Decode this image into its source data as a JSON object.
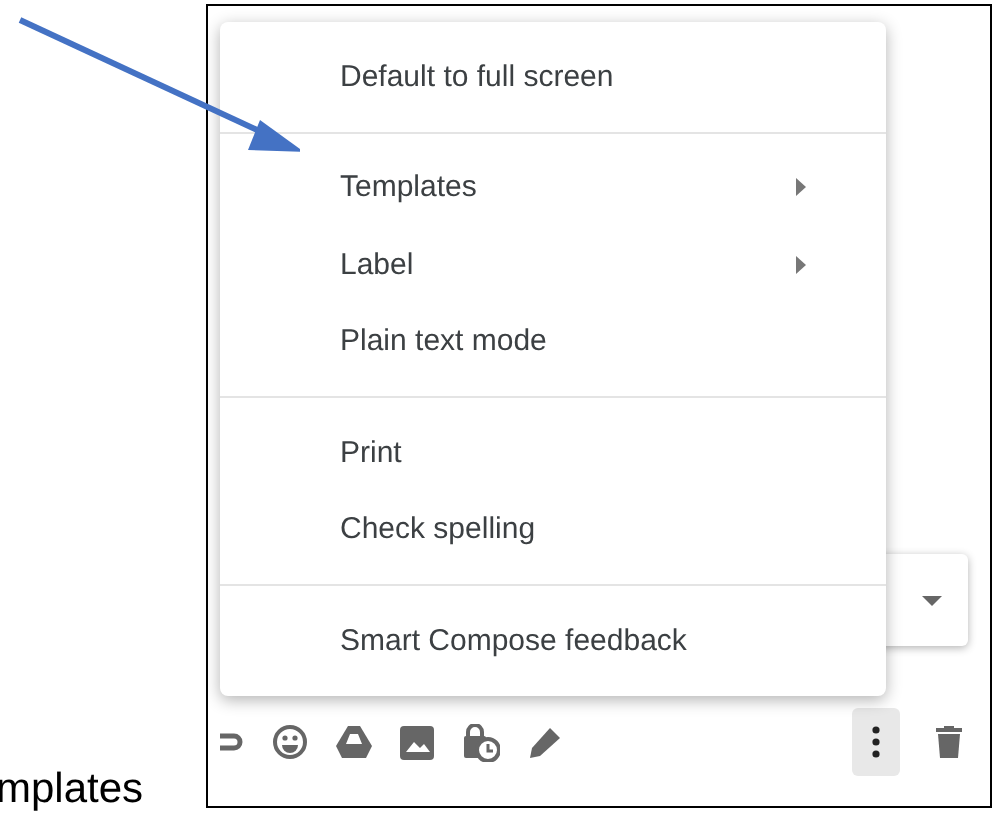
{
  "menu": {
    "items": [
      {
        "kind": "item",
        "label": "Default to full screen",
        "has_submenu": false
      },
      {
        "kind": "divider"
      },
      {
        "kind": "item",
        "label": "Templates",
        "has_submenu": true
      },
      {
        "kind": "item",
        "label": "Label",
        "has_submenu": true
      },
      {
        "kind": "item",
        "label": "Plain text mode",
        "has_submenu": false
      },
      {
        "kind": "divider"
      },
      {
        "kind": "item",
        "label": "Print",
        "has_submenu": false
      },
      {
        "kind": "item",
        "label": "Check spelling",
        "has_submenu": false
      },
      {
        "kind": "divider"
      },
      {
        "kind": "item",
        "label": "Smart Compose feedback",
        "has_submenu": false
      }
    ]
  },
  "toolbar": {
    "more_options_active": true
  },
  "caption": "mplates"
}
